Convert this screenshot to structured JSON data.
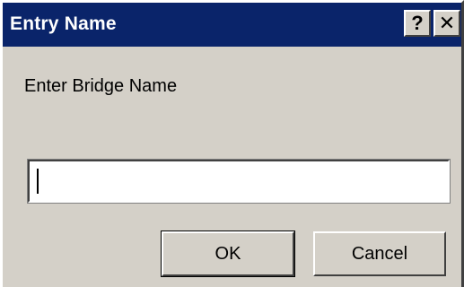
{
  "window": {
    "title": "Entry Name",
    "help_label": "?",
    "close_label": "✕"
  },
  "dialog": {
    "prompt": "Enter Bridge Name",
    "entry_value": "",
    "ok_label": "OK",
    "cancel_label": "Cancel"
  },
  "icons": {
    "help": "question-mark-icon",
    "close": "close-icon"
  },
  "colors": {
    "titlebar": "#0a246a",
    "face": "#d4d0c8",
    "title_text": "#ffffff"
  }
}
